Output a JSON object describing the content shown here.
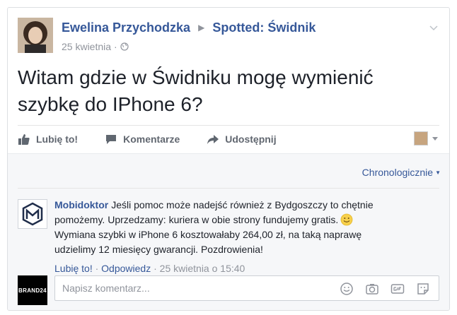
{
  "post": {
    "author": "Ewelina Przychodzka",
    "group": "Spotted: Świdnik",
    "date": "25 kwietnia",
    "date_separator": "·",
    "text": "Witam gdzie w Świdniku mogę wymienić szybkę do IPhone 6?"
  },
  "actions": {
    "like": "Lubię to!",
    "comment": "Komentarze",
    "share": "Udostępnij"
  },
  "comments_section": {
    "sort_label": "Chronologicznie",
    "comment": {
      "author": "Mobidoktor",
      "text_line_1": "Jeśli pomoc może nadejść również z Bydgoszczy to chętnie pomożemy. Uprzedzamy: kuriera w obie strony fundujemy gratis.",
      "text_line_2": "Wymiana szybki w iPhone 6 kosztowałaby 264,00 zł, na taką naprawę udzielimy 12 miesięcy gwarancji. Pozdrowienia!",
      "like_link": "Lubię to!",
      "reply_link": "Odpowiedz",
      "timestamp": "25 kwietnia o 15:40",
      "separator": "·"
    },
    "reply": {
      "avatar_text": "BRAND24",
      "placeholder": "Napisz komentarz..."
    }
  },
  "colors": {
    "link": "#365899",
    "meta": "#90949c",
    "text": "#1d2129"
  },
  "icons": [
    "globe-icon",
    "chevron-down-icon",
    "like-icon",
    "comment-icon",
    "share-icon",
    "smiley-icon",
    "emoji-icon",
    "camera-icon",
    "gif-icon",
    "sticker-icon"
  ]
}
